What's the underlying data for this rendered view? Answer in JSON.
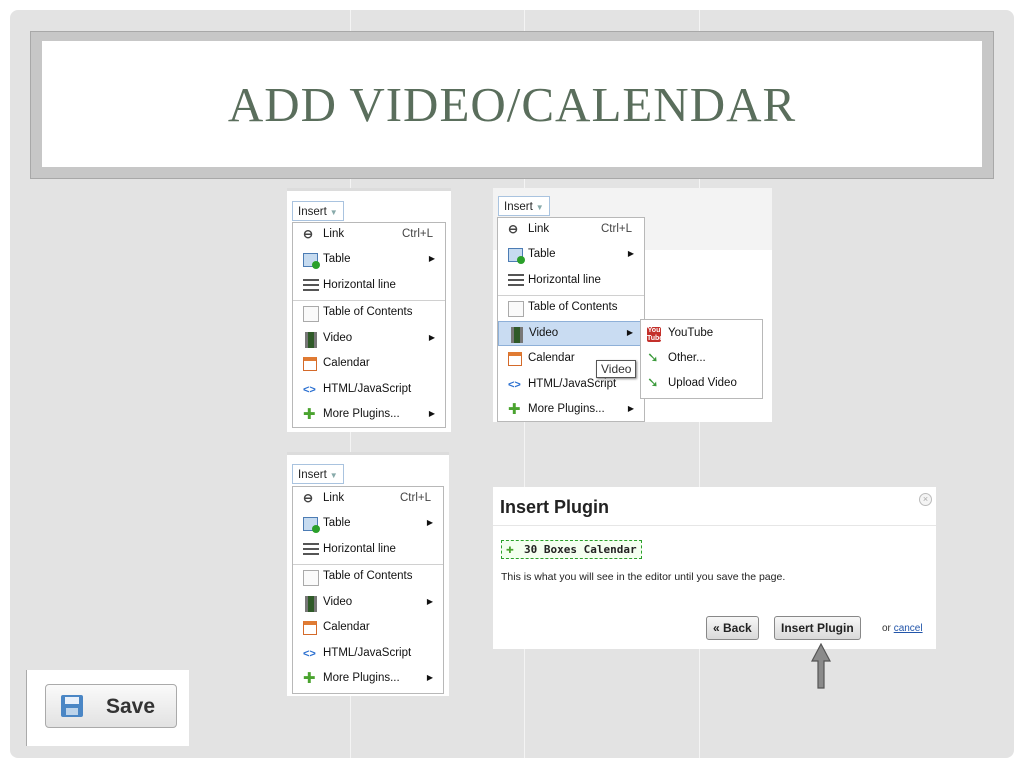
{
  "title": "ADD VIDEO/CALENDAR",
  "insert_button": "Insert",
  "menu": {
    "link": {
      "label": "Link",
      "shortcut": "Ctrl+L"
    },
    "table": {
      "label": "Table"
    },
    "horizontal_line": {
      "label": "Horizontal line"
    },
    "table_of_contents": {
      "label": "Table of Contents"
    },
    "video": {
      "label": "Video"
    },
    "calendar": {
      "label": "Calendar"
    },
    "html_js": {
      "label": "HTML/JavaScript"
    },
    "more_plugins": {
      "label": "More Plugins..."
    }
  },
  "video_submenu": {
    "youtube_icon_text": "You Tube",
    "youtube": "YouTube",
    "other": "Other...",
    "upload": "Upload Video"
  },
  "tooltip": "Video",
  "dialog": {
    "title": "Insert Plugin",
    "plugin_name": "30 Boxes Calendar",
    "description": "This is what you will see in the editor until you save the page.",
    "back_button": "« Back",
    "insert_button": "Insert Plugin",
    "or_text": "or",
    "cancel_link": "cancel"
  },
  "save_button": "Save",
  "icons": [
    "link-icon",
    "table-icon",
    "horizontal-line-icon",
    "document-icon",
    "film-icon",
    "calendar-icon",
    "code-icon",
    "puzzle-icon",
    "youtube-icon",
    "green-arrow-icon",
    "floppy-disk-icon",
    "close-icon",
    "up-arrow-icon"
  ],
  "colors": {
    "title": "#5a6e5c",
    "slide_bg": "#e3e3e3",
    "menu_highlight": "#c9dcf2",
    "plugin_border": "#2aa02a"
  }
}
